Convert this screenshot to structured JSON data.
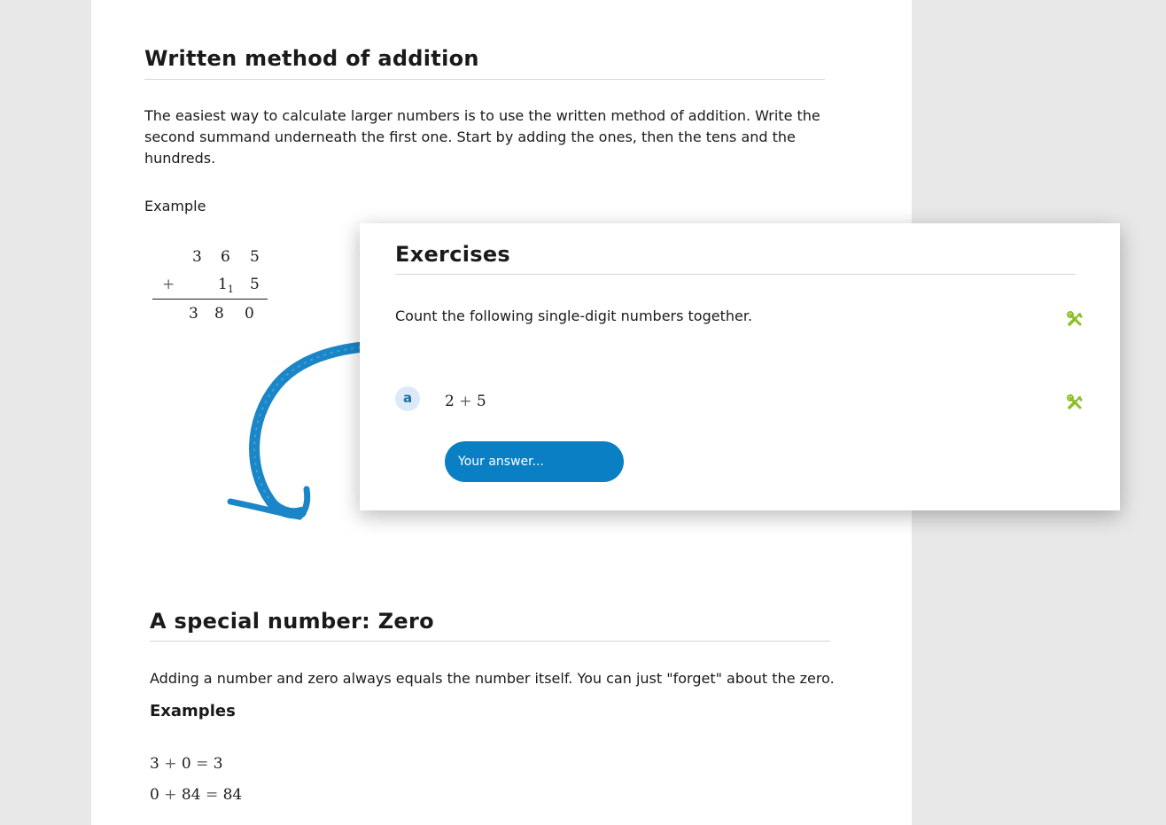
{
  "written_method": {
    "title": "Written method of addition",
    "text": "The easiest way to calculate larger numbers is to use the written method of addition. Write the second summand underneath the first one. Start by adding the ones, then the tens and the hundreds.",
    "example_label": "Example",
    "example": {
      "row1": [
        "3",
        "6",
        "5"
      ],
      "operator": "+",
      "row2_tens": "1",
      "row2_carry": "1",
      "row2_ones": "5",
      "result": [
        "3",
        "8",
        "0"
      ]
    }
  },
  "exercises": {
    "title": "Exercises",
    "instruction": "Count the following single-digit numbers together.",
    "items": [
      {
        "label": "a",
        "a": "2",
        "operator": "+",
        "b": "5",
        "answer_placeholder": "Your answer..."
      }
    ],
    "icon": "tools-icon",
    "icon_color": "#8cbf26"
  },
  "zero_section": {
    "title": "A special number: Zero",
    "text": "Adding a number and zero always equals the number itself. You can just \"forget\" about the zero.",
    "examples_heading": "Examples",
    "examples": [
      {
        "a": "3",
        "op": "+",
        "b": "0",
        "eq": "=",
        "result": "3"
      },
      {
        "a": "0",
        "op": "+",
        "b": "84",
        "eq": "=",
        "result": "84"
      }
    ]
  },
  "colors": {
    "accent": "#0a7fc4",
    "arrow": "#1a86c8",
    "page_bg": "#e8e8e8"
  }
}
